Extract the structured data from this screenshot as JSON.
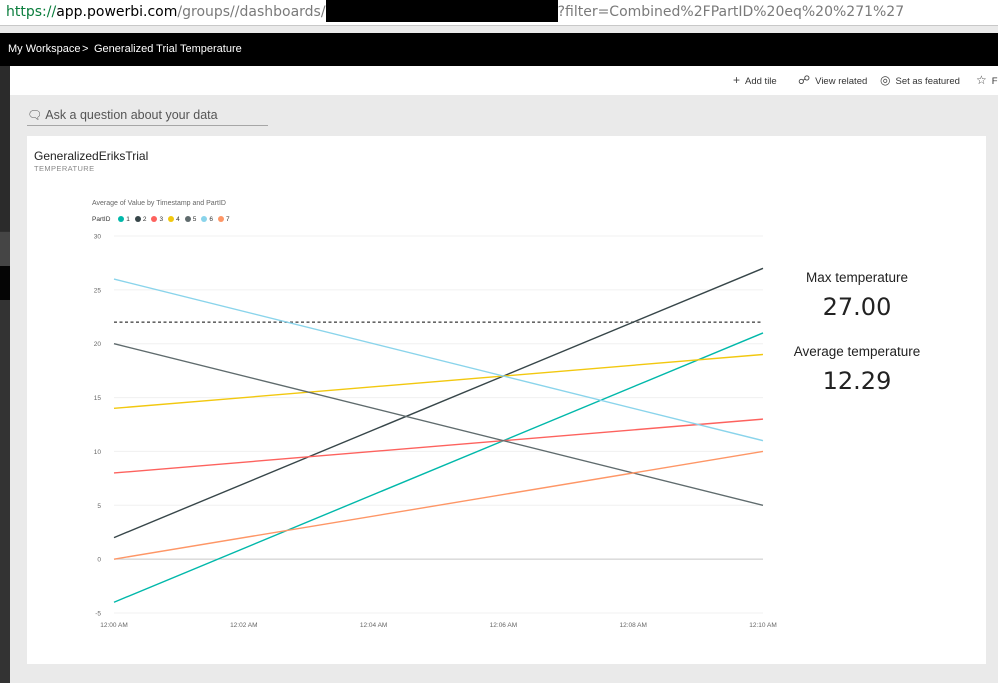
{
  "address_bar": {
    "scheme": "https://",
    "host": "app.powerbi.com",
    "path": "/groups//dashboards/",
    "query": "?filter=Combined%2FPartID%20eq%20%271%27"
  },
  "breadcrumb": {
    "workspace": "My Workspace",
    "separator": ">",
    "dashboard": "Generalized Trial Temperature"
  },
  "toolbar": {
    "add_tile": "Add tile",
    "view_related": "View related",
    "set_featured": "Set as featured",
    "favorite_partial": "Fa"
  },
  "qa": {
    "placeholder": "Ask a question about your data"
  },
  "tile": {
    "title": "GeneralizedEriksTrial",
    "subtitle": "TEMPERATURE",
    "kpis": [
      {
        "label": "Max temperature",
        "value": "27.00"
      },
      {
        "label": "Average temperature",
        "value": "12.29"
      }
    ]
  },
  "colors": {
    "p1": "#01b8aa",
    "p2": "#374649",
    "p3": "#fd625e",
    "p4": "#f2c80f",
    "p5": "#5f6b6d",
    "p6": "#8ad4eb",
    "p7": "#fe9666",
    "reference": "#666666"
  },
  "chart_data": {
    "type": "line",
    "title": "Average of Value by Timestamp and PartID",
    "legend_title": "PartID",
    "legend_position": "top-left",
    "x": [
      "12:00 AM",
      "12:10 AM"
    ],
    "x_ticks": [
      "12:00 AM",
      "12:02 AM",
      "12:04 AM",
      "12:06 AM",
      "12:08 AM",
      "12:10 AM"
    ],
    "x_range_minutes": [
      0,
      10
    ],
    "y_ticks": [
      -5,
      0,
      5,
      10,
      15,
      20,
      25,
      30
    ],
    "ylim": [
      -5,
      30
    ],
    "grid": true,
    "reference_line": 22,
    "series": [
      {
        "name": "1",
        "color": "#01b8aa",
        "values": [
          -4,
          21
        ]
      },
      {
        "name": "2",
        "color": "#374649",
        "values": [
          2,
          27
        ]
      },
      {
        "name": "3",
        "color": "#fd625e",
        "values": [
          8,
          13
        ]
      },
      {
        "name": "4",
        "color": "#f2c80f",
        "values": [
          14,
          19
        ]
      },
      {
        "name": "5",
        "color": "#5f6b6d",
        "values": [
          20,
          5
        ]
      },
      {
        "name": "6",
        "color": "#8ad4eb",
        "values": [
          26,
          11
        ]
      },
      {
        "name": "7",
        "color": "#fe9666",
        "values": [
          0,
          10
        ]
      }
    ]
  }
}
